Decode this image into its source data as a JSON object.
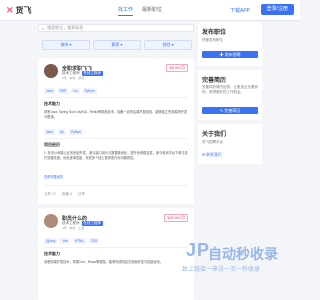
{
  "header": {
    "logo_mark": "✕",
    "logo_text": "货飞",
    "nav": [
      "找工作",
      "最新职位"
    ],
    "login": "下载APP",
    "register_btn": "登录/注册"
  },
  "search": {
    "placeholder": "搜索职位，搜索标签"
  },
  "filters": [
    "城市",
    "薪资",
    "经验"
  ],
  "cards": [
    {
      "name": "全职求职飞飞",
      "role": "技术工程师",
      "badge": "在线工程师",
      "meta": "2年 · 本科 · 深圳",
      "price": "¥8.0K/月",
      "tags": [
        "Java",
        "PHP",
        "Go",
        "Python"
      ],
      "sec1_title": "技术能力",
      "sec1_text": "熟悉Java, Spring Boot, MySQL, Redis等常用技术，具备一定的后端开发经验，能够独立完成模块开发与联调。",
      "sec1_tags": [
        "Java",
        "Go",
        "Python"
      ],
      "sec2_title": "项目经历",
      "sec2_text": "1. 负责公司核心业务系统开发，参与接口设计与数据库优化，提升系统稳定性。参与电商平台下单与支付流程改造，优化查询性能，完成多个线上需求迭代与问题修复。",
      "sec2_link": "查看完整经历",
      "actions": [
        "点赞 12",
        "收藏 8",
        "分享"
      ]
    },
    {
      "name": "职员什么的",
      "role": "技术工程师",
      "badge": "在线工程师",
      "meta": "3年 · 本科 · 上海",
      "price": "¥25.0K/月",
      "tags": [
        "jQuery",
        "Vue",
        "HTML",
        "CSS"
      ],
      "sec1_title": "技术能力",
      "sec1_text": "熟悉前端开发技术，掌握Vue、React等框架，能够完成响应式页面开发与性能优化。"
    }
  ],
  "side": {
    "post_title": "发布职位",
    "post_text": "快速发布职位",
    "post_btn": "发布招聘",
    "resume_title": "完善简历",
    "resume_text": "完善你的简历信息，让更多企业看到你，获得更好的工作机会。",
    "resume_btn": "完善简历",
    "about_title": "关于我们",
    "about_text": "货飞招聘平台",
    "about_link": "联系我们"
  },
  "watermark": {
    "logo": "JP",
    "text": "自动秒收录",
    "sub": "致上链接一来访一次一秒收录"
  }
}
